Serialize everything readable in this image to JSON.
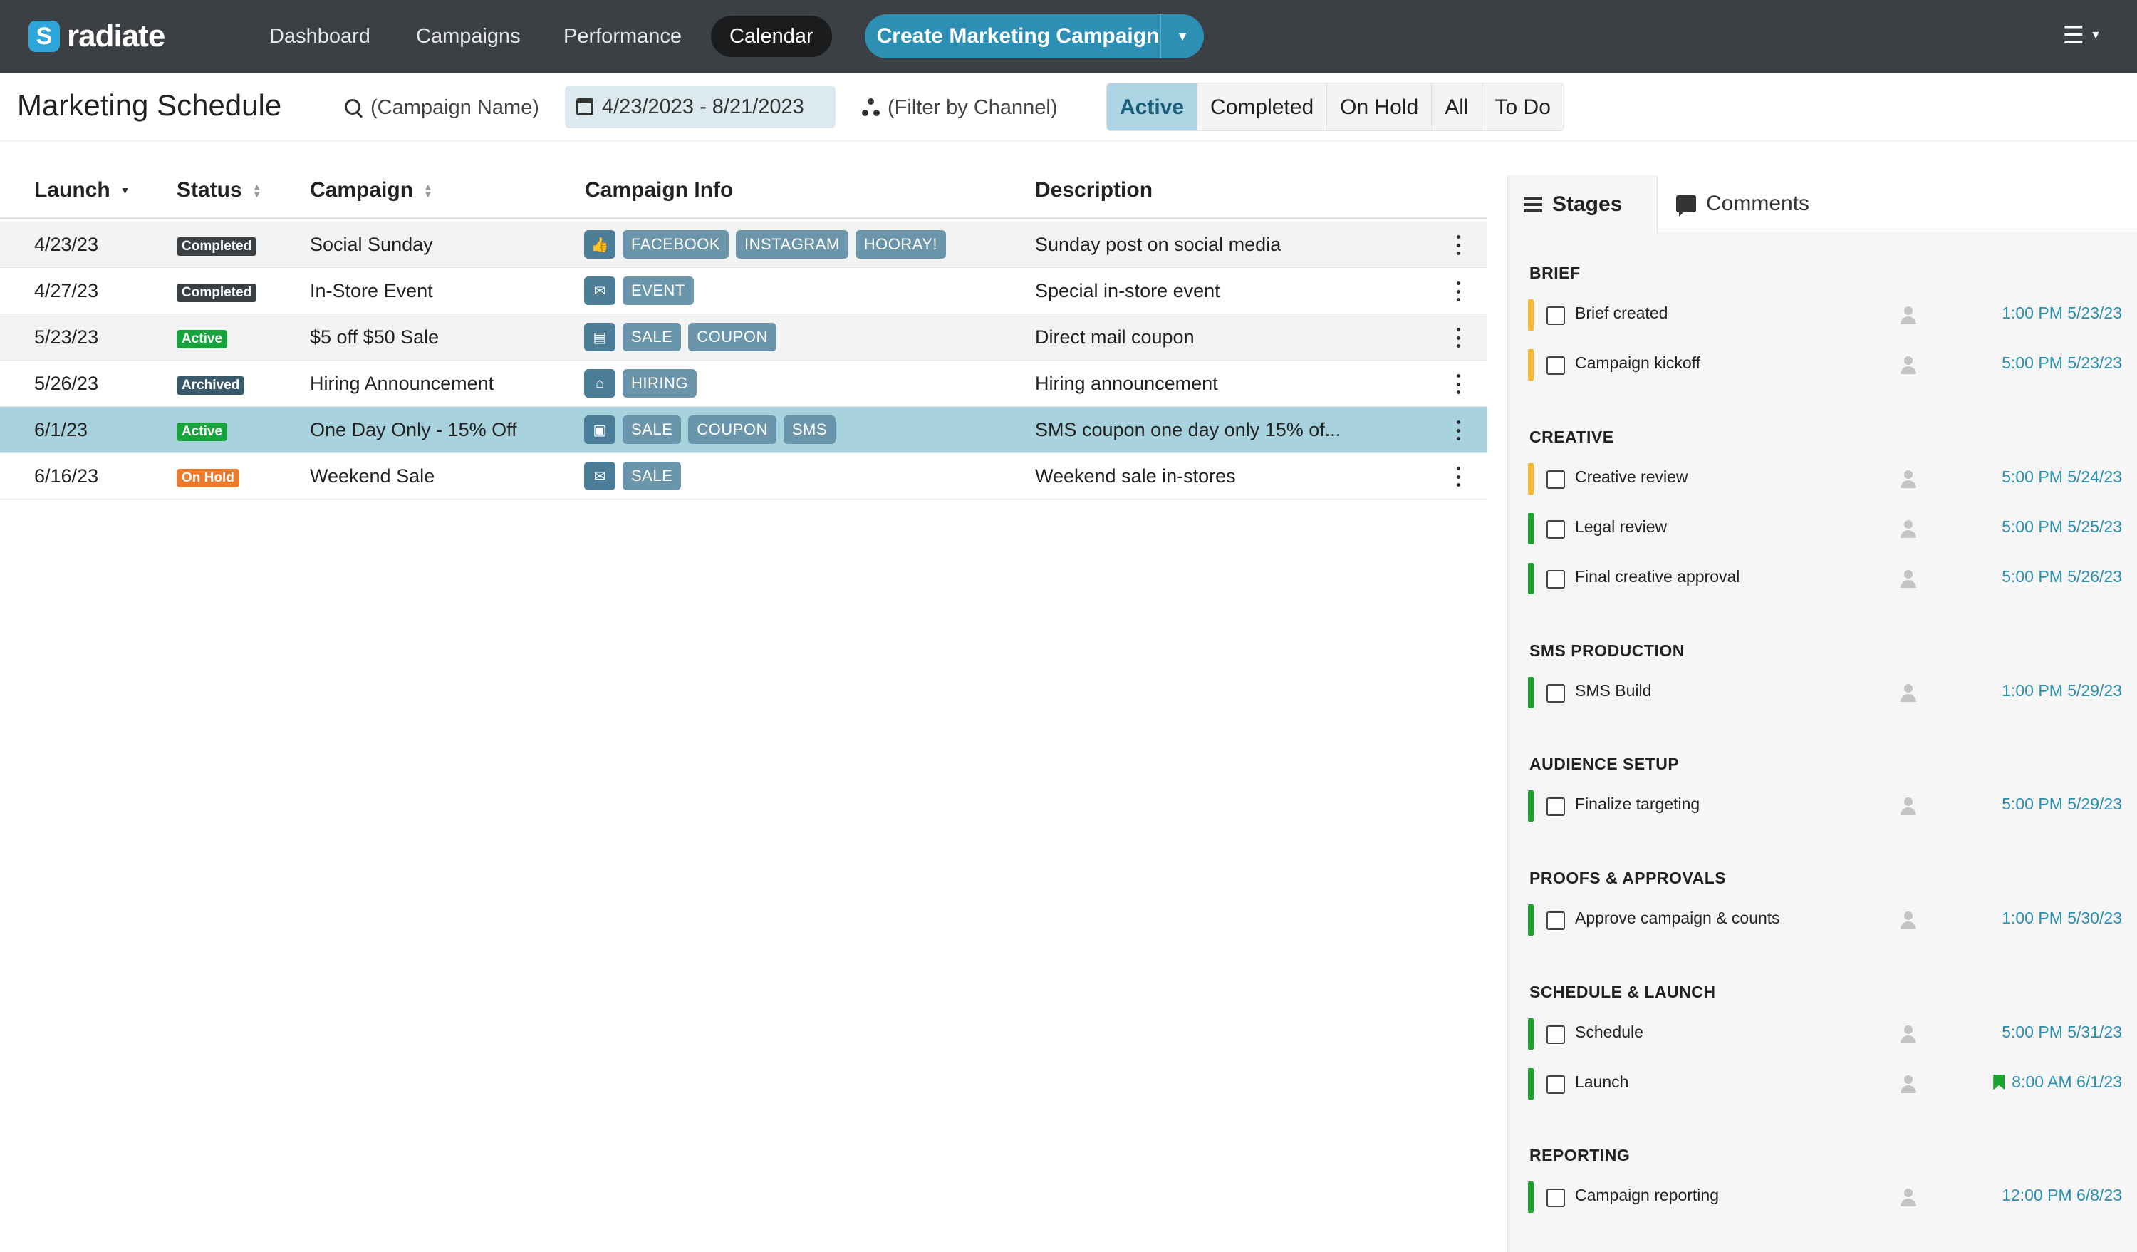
{
  "app": {
    "name": "radiate",
    "logo_letter": "S"
  },
  "nav": {
    "items": [
      "Dashboard",
      "Campaigns",
      "Performance",
      "Calendar"
    ],
    "active": "Calendar",
    "create_label": "Create Marketing Campaign"
  },
  "toolbar": {
    "title": "Marketing Schedule",
    "search_placeholder": "(Campaign Name)",
    "date_range": "4/23/2023 - 8/21/2023",
    "channel_placeholder": "(Filter by Channel)",
    "filters": [
      "Active",
      "Completed",
      "On Hold",
      "All",
      "To Do"
    ],
    "active_filter": "Active"
  },
  "table": {
    "headers": {
      "launch": "Launch",
      "status": "Status",
      "campaign": "Campaign",
      "info": "Campaign Info",
      "description": "Description"
    },
    "rows": [
      {
        "launch": "4/23/23",
        "status": "Completed",
        "status_class": "b-completed",
        "campaign": "Social Sunday",
        "channel_icon": "thumbs-up-icon",
        "tags": [
          "FACEBOOK",
          "INSTAGRAM",
          "HOORAY!"
        ],
        "description": "Sunday post on social media"
      },
      {
        "launch": "4/27/23",
        "status": "Completed",
        "status_class": "b-completed",
        "campaign": "In-Store Event",
        "channel_icon": "envelope-icon",
        "tags": [
          "EVENT"
        ],
        "description": "Special in-store event"
      },
      {
        "launch": "5/23/23",
        "status": "Active",
        "status_class": "b-active",
        "campaign": "$5 off $50 Sale",
        "channel_icon": "newspaper-icon",
        "tags": [
          "SALE",
          "COUPON"
        ],
        "description": "Direct mail coupon"
      },
      {
        "launch": "5/26/23",
        "status": "Archived",
        "status_class": "b-archived",
        "campaign": "Hiring Announcement",
        "channel_icon": "building-icon",
        "tags": [
          "HIRING"
        ],
        "description": "Hiring announcement"
      },
      {
        "launch": "6/1/23",
        "status": "Active",
        "status_class": "b-active",
        "campaign": "One Day Only - 15% Off",
        "channel_icon": "sms-icon",
        "tags": [
          "SALE",
          "COUPON",
          "SMS"
        ],
        "description": "SMS coupon one day only 15% of..."
      },
      {
        "launch": "6/16/23",
        "status": "On Hold",
        "status_class": "b-onhold",
        "campaign": "Weekend Sale",
        "channel_icon": "envelope-icon",
        "tags": [
          "SALE"
        ],
        "description": "Weekend sale in-stores"
      }
    ],
    "selected_row": 4
  },
  "panel": {
    "tabs": [
      "Stages",
      "Comments"
    ],
    "active_tab": "Stages",
    "sections": [
      {
        "title": "BRIEF",
        "tasks": [
          {
            "name": "Brief created",
            "due": "1:00 PM 5/23/23",
            "bar": "bar-y"
          },
          {
            "name": "Campaign kickoff",
            "due": "5:00 PM 5/23/23",
            "bar": "bar-y"
          }
        ]
      },
      {
        "title": "CREATIVE",
        "tasks": [
          {
            "name": "Creative review",
            "due": "5:00 PM 5/24/23",
            "bar": "bar-y"
          },
          {
            "name": "Legal review",
            "due": "5:00 PM 5/25/23",
            "bar": "bar-g"
          },
          {
            "name": "Final creative approval",
            "due": "5:00 PM 5/26/23",
            "bar": "bar-g"
          }
        ]
      },
      {
        "title": "SMS PRODUCTION",
        "tasks": [
          {
            "name": "SMS Build",
            "due": "1:00 PM 5/29/23",
            "bar": "bar-g"
          }
        ]
      },
      {
        "title": "AUDIENCE SETUP",
        "tasks": [
          {
            "name": "Finalize targeting",
            "due": "5:00 PM 5/29/23",
            "bar": "bar-g"
          }
        ]
      },
      {
        "title": "PROOFS & APPROVALS",
        "tasks": [
          {
            "name": "Approve campaign & counts",
            "due": "1:00 PM 5/30/23",
            "bar": "bar-g"
          }
        ]
      },
      {
        "title": "SCHEDULE & LAUNCH",
        "tasks": [
          {
            "name": "Schedule",
            "due": "5:00 PM 5/31/23",
            "bar": "bar-g"
          },
          {
            "name": "Launch",
            "due": "8:00 AM 6/1/23",
            "bar": "bar-g",
            "flag": true
          }
        ]
      },
      {
        "title": "REPORTING",
        "tasks": [
          {
            "name": "Campaign reporting",
            "due": "12:00 PM 6/8/23",
            "bar": "bar-g"
          }
        ]
      }
    ]
  },
  "colors": {
    "topbar": "#3c4044",
    "accent": "#2e8fb5",
    "active_badge": "#19a33c",
    "on_hold_badge": "#ec7a2b",
    "selected_row": "#a9d2df"
  }
}
